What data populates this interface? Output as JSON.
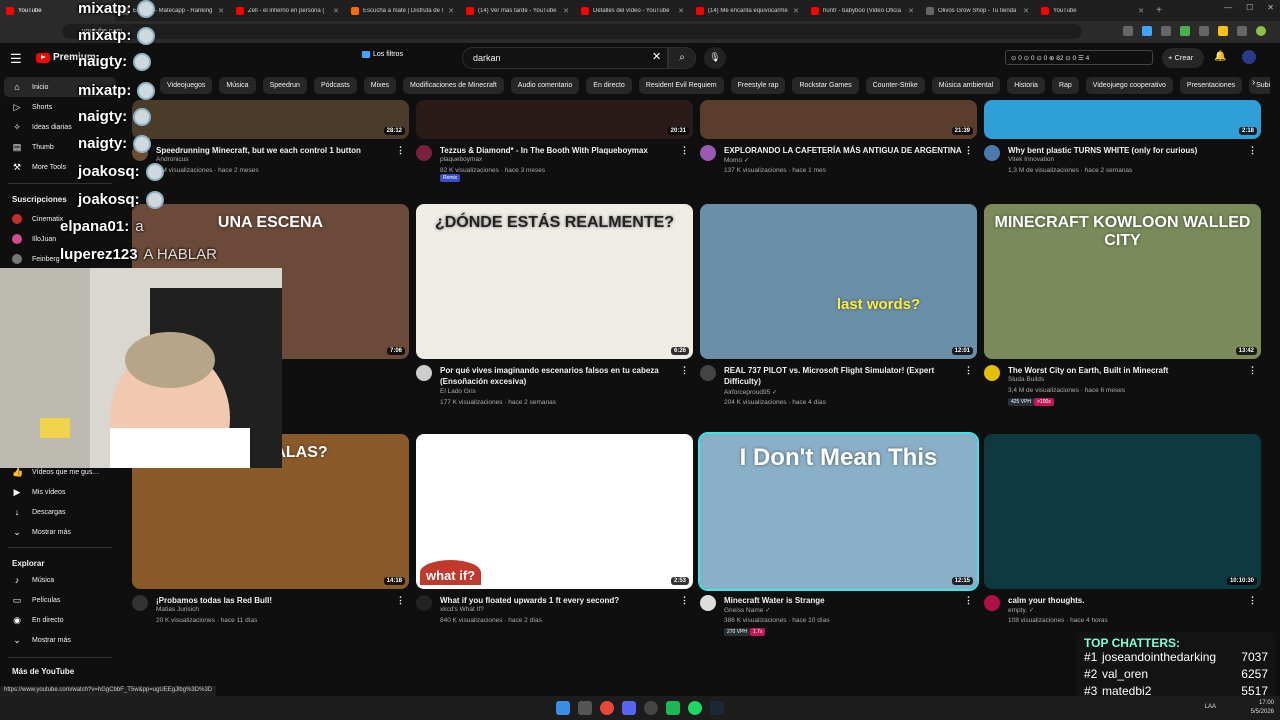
{
  "browser": {
    "tabs": [
      {
        "title": "YouTube",
        "color": "#ff0000"
      },
      {
        "title": "Emotes - Matecapp - Ranking",
        "color": "#5a5a5a"
      },
      {
        "title": "Zell - el infierno en persona (",
        "color": "#ff0000"
      },
      {
        "title": "Escucha a mate | Disfruta de l",
        "color": "#ff6a00"
      },
      {
        "title": "(14) Ver más tarde - YouTube",
        "color": "#ff0000"
      },
      {
        "title": "Detalles del vídeo - YouTube",
        "color": "#ff0000"
      },
      {
        "title": "(14) Me encanta equivocarme",
        "color": "#ff0000"
      },
      {
        "title": "huntr - babyboo (Video Oficia",
        "color": "#ff0000"
      },
      {
        "title": "Olivos Grow Shop - Tu tienda",
        "color": "#666666"
      },
      {
        "title": "YouTube",
        "color": "#ff0000"
      }
    ],
    "new_tab": "+",
    "url": "youtube.com",
    "status_url": "https://www.youtube.com/watch?v=hGgCbbF_T5w&pp=ugUEEgJlbg%3D%3D"
  },
  "header": {
    "logo": "Premium",
    "filters_label": "Los filtros",
    "search_value": "darkan",
    "stats": "⊙ 0  ⊙ 0  ⊙ 0  ⊕ 82  ⊙ 0  ☰ 4",
    "create_label": "+ Crear"
  },
  "chips": [
    "Videojuegos",
    "Música",
    "Speedrun",
    "Pódcasts",
    "Mixes",
    "Modificaciones de Minecraft",
    "Audio comentario",
    "En directo",
    "Resident Evil Requiem",
    "Freestyle rap",
    "Rockstar Games",
    "Counter-Strike",
    "Música ambiental",
    "Historia",
    "Rap",
    "Videojuego cooperativo",
    "Presentaciones",
    "Subidas re"
  ],
  "sidebar": {
    "items": [
      {
        "label": "Inicio",
        "icon": "⌂"
      },
      {
        "label": "Shorts",
        "icon": "▷"
      },
      {
        "label": "Ideas diarias",
        "icon": "✧"
      },
      {
        "label": "Thumb",
        "icon": "▤"
      },
      {
        "label": "More Tools",
        "icon": "⚒"
      }
    ],
    "subs_head": "Suscripciones",
    "subs": [
      {
        "label": "Cinematix",
        "color": "#c43030"
      },
      {
        "label": "IlloJuan",
        "color": "#d04c8c"
      },
      {
        "label": "Feinberg",
        "color": "#777777"
      }
    ],
    "you_items": [
      {
        "label": "Vídeos que me gus…",
        "icon": "👍"
      },
      {
        "label": "Mis vídeos",
        "icon": "▶"
      },
      {
        "label": "Descargas",
        "icon": "↓"
      },
      {
        "label": "Mostrar más",
        "icon": "⌄"
      }
    ],
    "explore_head": "Explorar",
    "explore": [
      {
        "label": "Música",
        "icon": "♪"
      },
      {
        "label": "Películas",
        "icon": "▭"
      },
      {
        "label": "En directo",
        "icon": "◉"
      },
      {
        "label": "Mostrar más",
        "icon": "⌄"
      }
    ],
    "more_head": "Más de YouTube"
  },
  "videos": [
    {
      "title": "Speedrunning Minecraft, but we each control 1 button",
      "channel": "Andronicus",
      "stats": "1 M visualizaciones · hace 2 meses",
      "duration": "28:12",
      "avatar": "#6d4c2f",
      "thumb": "#4b3b2a"
    },
    {
      "title": "Tezzus & Diamond* - In The Booth With Plaqueboymax",
      "channel": "plaqueboymax",
      "stats": "82 K visualizaciones · hace 3 meses",
      "duration": "20:31",
      "avatar": "#7a1f3d",
      "thumb": "#2a1a1a",
      "badge": "Remix"
    },
    {
      "title": "EXPLORANDO LA CAFETERÍA MÁS ANTIGUA DE ARGENTINA",
      "channel": "Momo ✓",
      "stats": "137 K visualizaciones · hace 1 mes",
      "duration": "21:39",
      "avatar": "#9b59b6",
      "thumb": "#5a3e2b"
    },
    {
      "title": "Why bent plastic TURNS WHITE (only for curious)",
      "channel": "Vitek Innovation",
      "stats": "1,3 M de visualizaciones · hace 2 semanas",
      "duration": "2:18",
      "avatar": "#4a7ab0",
      "thumb": "#2f9fd8"
    },
    {
      "title": "",
      "channel": "",
      "stats": "",
      "duration": "7:06",
      "avatar": "#333333",
      "thumb": "#6b4a3a",
      "thumb_text": "UNA ESCENA"
    },
    {
      "title": "Por qué vives imaginando escenarios falsos en tu cabeza (Ensoñación excesiva)",
      "channel": "El Lado Gris",
      "stats": "177 K visualizaciones · hace 2 semanas",
      "duration": "6:26",
      "avatar": "#cccccc",
      "thumb": "#efece6",
      "thumb_text": "¿DÓNDE ESTÁS REALMENTE?"
    },
    {
      "title": "REAL 737 PILOT vs. Microsoft Flight Simulator! (Expert Difficulty)",
      "channel": "Airforceproud95 ✓",
      "stats": "204 K visualizaciones · hace 4 días",
      "duration": "12:01",
      "avatar": "#444444",
      "thumb": "#6b8fa8",
      "thumb_text": "last words?"
    },
    {
      "title": "The Worst City on Earth, Built in Minecraft",
      "channel": "Sluda Builds",
      "stats": "3,4 M de visualizaciones · hace 6 meses",
      "duration": "13:42",
      "avatar": "#e0c000",
      "thumb": "#7a8a5a",
      "thumb_text": "MINECRAFT KOWLOON WALLED CITY",
      "badges": [
        "425 VPH",
        ">100x"
      ]
    },
    {
      "title": "¡Probamos todas las Red Bull!",
      "channel": "Matias Jurisich",
      "stats": "20 K visualizaciones · hace 11 días",
      "duration": "14:18",
      "avatar": "#333333",
      "thumb": "#8a5a2a",
      "thumb_text": "¿TE DA ALAS?"
    },
    {
      "title": "What if you floated upwards 1 ft every second?",
      "channel": "xkcd's What If?",
      "stats": "840 K visualizaciones · hace 2 días",
      "duration": "2:53",
      "avatar": "#222222",
      "thumb": "#ffffff",
      "thumb_text": "what if?"
    },
    {
      "title": "Minecraft Water is Strange",
      "channel": "Gneiss Name ✓",
      "stats": "386 K visualizaciones · hace 10 días",
      "duration": "12:15",
      "avatar": "#dddddd",
      "thumb": "#8ab0c8",
      "thumb_text": "I Don't Mean This",
      "badges": [
        "270 VPH",
        "1.7x"
      ]
    },
    {
      "title": "calm your thoughts.",
      "channel": "empty. ✓",
      "stats": "108 visualizaciones · hace 4 horas",
      "duration": "10:10:30",
      "avatar": "#b0104a",
      "thumb": "#0d3a40"
    }
  ],
  "stream": {
    "chat": [
      {
        "user": "mixatp:"
      },
      {
        "user": "mixatp:"
      },
      {
        "user": "naigty:"
      },
      {
        "user": "mixatp:"
      },
      {
        "user": "naigty:"
      },
      {
        "user": "naigty:"
      },
      {
        "user": "joakosq:"
      },
      {
        "user": "joakosq:"
      },
      {
        "user": "elpana01:",
        "msg": "a"
      },
      {
        "user": "luperez123",
        "msg": "A HABLAR"
      }
    ],
    "top_chatters_title": "TOP CHATTERS:",
    "top_chatters": [
      {
        "rank": "#1",
        "name": "joseandointhedarking",
        "count": "7037"
      },
      {
        "rank": "#2",
        "name": "val_oren",
        "count": "6257"
      },
      {
        "rank": "#3",
        "name": "matedbi2",
        "count": "5517"
      }
    ]
  },
  "taskbar": {
    "lang": "LAA",
    "time": "17:00",
    "date": "5/5/2026"
  }
}
